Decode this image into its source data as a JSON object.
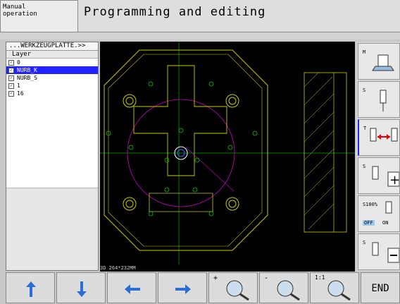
{
  "header": {
    "mode_label": "Manual\noperation",
    "title": "Programming and editing"
  },
  "layer_tree": {
    "path": "...WERKZEUGPLATTE.>>",
    "column_header": "Layer",
    "items": [
      {
        "label": "0",
        "checked": true,
        "selected": false
      },
      {
        "label": "NURB_K",
        "checked": true,
        "selected": true
      },
      {
        "label": "NURB_S",
        "checked": true,
        "selected": false
      },
      {
        "label": "1",
        "checked": true,
        "selected": false
      },
      {
        "label": "16",
        "checked": true,
        "selected": false
      }
    ]
  },
  "canvas": {
    "status_text": "3D  264*232MM"
  },
  "side_softkeys": [
    {
      "label": "M",
      "icon": "m-function-icon"
    },
    {
      "label": "S",
      "icon": "spindle-icon"
    },
    {
      "label": "T",
      "icon": "tool-change-icon"
    },
    {
      "label": "S",
      "icon": "spindle-plus-icon"
    },
    {
      "label": "S100%",
      "sublabel_off": "OFF",
      "sublabel_on": "ON",
      "icon": "spindle-override-icon"
    },
    {
      "label": "S",
      "icon": "spindle-minus-icon"
    }
  ],
  "bottom_softkeys": [
    {
      "name": "arrow-up",
      "icon": "arrow-up-icon"
    },
    {
      "name": "arrow-down",
      "icon": "arrow-down-icon"
    },
    {
      "name": "arrow-left",
      "icon": "arrow-left-icon"
    },
    {
      "name": "arrow-right",
      "icon": "arrow-right-icon"
    },
    {
      "name": "zoom-in",
      "label": "+",
      "icon": "zoom-in-icon"
    },
    {
      "name": "zoom-out",
      "label": "-",
      "icon": "zoom-out-icon"
    },
    {
      "name": "zoom-reset",
      "label": "1:1",
      "icon": "zoom-reset-icon"
    },
    {
      "name": "end",
      "label": "END"
    }
  ],
  "colors": {
    "accent": "#2222ff",
    "drawing_yellow": "#cccc00",
    "drawing_green": "#00cc00",
    "drawing_magenta": "#cc00cc"
  }
}
